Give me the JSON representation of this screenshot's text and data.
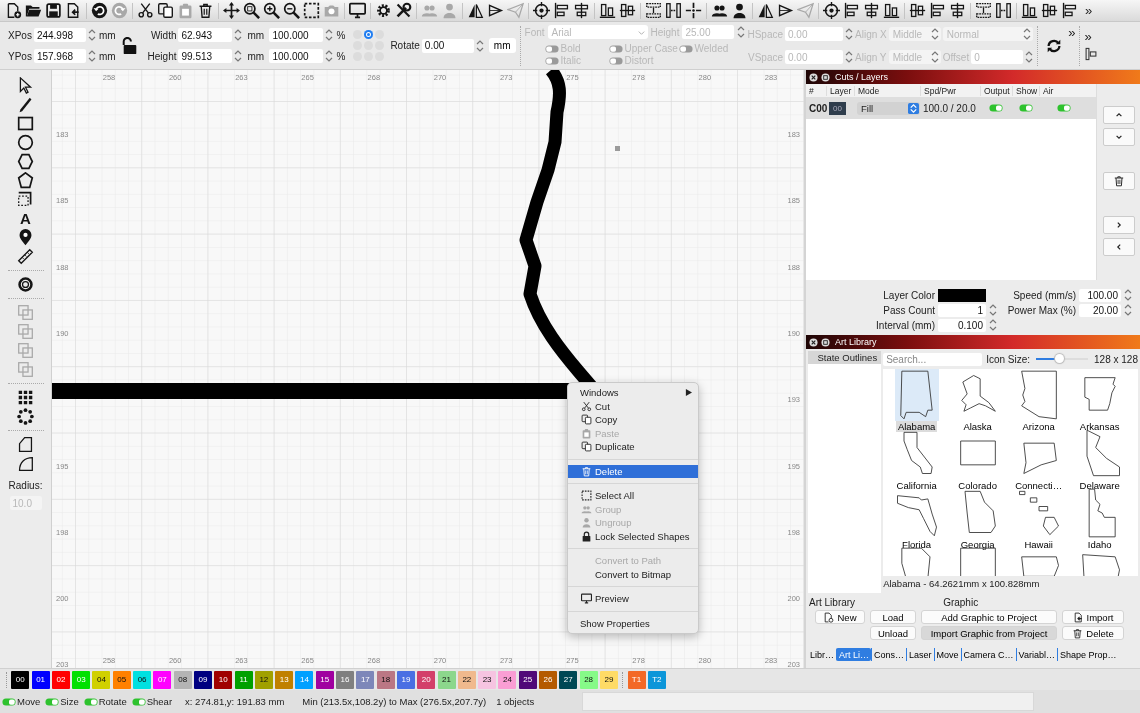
{
  "toolbar": [
    {
      "kind": "file-add",
      "disabled": false
    },
    {
      "kind": "folder",
      "disabled": false
    },
    {
      "kind": "save",
      "disabled": false
    },
    {
      "kind": "import",
      "disabled": false
    },
    {
      "kind": "separator"
    },
    {
      "kind": "undo",
      "disabled": false
    },
    {
      "kind": "redo",
      "disabled": true
    },
    {
      "kind": "separator"
    },
    {
      "kind": "cut",
      "disabled": false
    },
    {
      "kind": "copy",
      "disabled": false
    },
    {
      "kind": "paste",
      "disabled": true
    },
    {
      "kind": "trash",
      "disabled": false
    },
    {
      "kind": "separator"
    },
    {
      "kind": "move",
      "disabled": false
    },
    {
      "kind": "zoom-frame",
      "disabled": false
    },
    {
      "kind": "zoom-in",
      "disabled": false
    },
    {
      "kind": "zoom-out",
      "disabled": false
    },
    {
      "kind": "select",
      "disabled": false
    },
    {
      "kind": "camera",
      "disabled": true
    },
    {
      "kind": "separator"
    },
    {
      "kind": "monitor",
      "disabled": false
    },
    {
      "kind": "separator"
    },
    {
      "kind": "gear",
      "disabled": false
    },
    {
      "kind": "wrench",
      "disabled": false
    },
    {
      "kind": "separator"
    },
    {
      "kind": "users",
      "disabled": true
    },
    {
      "kind": "user",
      "disabled": true
    },
    {
      "kind": "separator"
    },
    {
      "kind": "flip",
      "disabled": false
    },
    {
      "kind": "mirror",
      "disabled": false
    },
    {
      "kind": "plane",
      "disabled": true
    },
    {
      "kind": "separator"
    },
    {
      "kind": "target",
      "disabled": false
    },
    {
      "kind": "align-a",
      "disabled": false
    },
    {
      "kind": "align-b",
      "disabled": false
    },
    {
      "kind": "separator"
    },
    {
      "kind": "align-c",
      "disabled": false
    },
    {
      "kind": "align-d",
      "disabled": false
    },
    {
      "kind": "separator"
    },
    {
      "kind": "dist-a",
      "disabled": false
    },
    {
      "kind": "dist-b",
      "disabled": false
    },
    {
      "kind": "cross",
      "disabled": false
    },
    {
      "kind": "separator"
    },
    {
      "kind": "users",
      "disabled": false
    },
    {
      "kind": "user",
      "disabled": false
    },
    {
      "kind": "separator"
    },
    {
      "kind": "flip",
      "disabled": false
    },
    {
      "kind": "mirror",
      "disabled": false
    },
    {
      "kind": "plane",
      "disabled": true
    },
    {
      "kind": "separator"
    },
    {
      "kind": "target",
      "disabled": false
    },
    {
      "kind": "align-a",
      "disabled": false
    },
    {
      "kind": "align-b",
      "disabled": false
    },
    {
      "kind": "align-c",
      "disabled": false
    },
    {
      "kind": "separator"
    },
    {
      "kind": "align-d",
      "disabled": false
    },
    {
      "kind": "align-a",
      "disabled": false
    },
    {
      "kind": "align-b",
      "disabled": false
    },
    {
      "kind": "separator"
    },
    {
      "kind": "dist-a",
      "disabled": false
    },
    {
      "kind": "dist-b",
      "disabled": false
    },
    {
      "kind": "separator"
    },
    {
      "kind": "align-c",
      "disabled": false
    },
    {
      "kind": "align-d",
      "disabled": false
    },
    {
      "kind": "align-a",
      "disabled": false
    }
  ],
  "toolbar_overflow": "»",
  "position": {
    "fields": [
      {
        "label": "XPos",
        "value": "244.998",
        "unit": "mm"
      },
      {
        "label": "YPos",
        "value": "157.968",
        "unit": "mm"
      }
    ],
    "locked": false
  },
  "size": {
    "fields": [
      {
        "label": "Width",
        "value": "62.943",
        "unit": "mm",
        "scale": "100.000",
        "scale_unit": "%"
      },
      {
        "label": "Height",
        "value": "99.513",
        "unit": "mm",
        "scale": "100.000",
        "scale_unit": "%"
      }
    ]
  },
  "origin_points": [
    {
      "selected": false
    },
    {
      "selected": true
    },
    {
      "selected": false
    },
    {
      "selected": false
    },
    {
      "selected": false
    },
    {
      "selected": false
    },
    {
      "selected": false
    },
    {
      "selected": false
    },
    {
      "selected": false
    }
  ],
  "rotate": {
    "label": "Rotate",
    "value": "0.00"
  },
  "unit_button": "mm",
  "text_options": {
    "disabled": true,
    "font": {
      "label": "Font",
      "value": "Arial"
    },
    "height": {
      "label": "Height",
      "value": "25.00"
    },
    "toggles": [
      {
        "label": "Bold",
        "on": false
      },
      {
        "label": "Upper Case",
        "on": false
      },
      {
        "label": "Welded",
        "on": false
      },
      {
        "label": "Italic",
        "on": false
      },
      {
        "label": "Distort",
        "on": false
      }
    ],
    "hspace": {
      "label": "HSpace",
      "value": "0.00"
    },
    "vspace": {
      "label": "VSpace",
      "value": "0.00"
    },
    "align_x": {
      "label": "Align X",
      "value": "Middle"
    },
    "align_y": {
      "label": "Align Y",
      "value": "Middle"
    },
    "mode": "Normal",
    "offset": {
      "label": "Offset",
      "value": "0"
    }
  },
  "panel_overflow": [
    "»",
    "»"
  ],
  "tools": [
    {
      "kind": "pointer",
      "disabled": false
    },
    {
      "kind": "pen",
      "disabled": false
    },
    {
      "kind": "rect",
      "disabled": false
    },
    {
      "kind": "ellipse",
      "disabled": false
    },
    {
      "kind": "hexagon",
      "disabled": false
    },
    {
      "kind": "polygon",
      "disabled": false
    },
    {
      "kind": "dash-square",
      "disabled": false
    },
    {
      "kind": "text",
      "label": "A",
      "disabled": false
    },
    {
      "kind": "pin",
      "disabled": false
    },
    {
      "kind": "ruler",
      "disabled": false
    },
    {
      "kind": "ring",
      "disabled": false
    },
    {
      "kind": "boolean",
      "disabled": true
    },
    {
      "kind": "boolean",
      "disabled": true
    },
    {
      "kind": "boolean",
      "disabled": true
    },
    {
      "kind": "boolean",
      "disabled": true
    },
    {
      "kind": "grid",
      "disabled": false
    },
    {
      "kind": "circle-array",
      "disabled": false
    },
    {
      "kind": "node",
      "disabled": false
    },
    {
      "kind": "node2",
      "disabled": false
    }
  ],
  "radius": {
    "label": "Radius:",
    "value": "10.0",
    "disabled": true
  },
  "canvas": {
    "top_ruler": [
      "258",
      "260",
      "263",
      "265",
      "268",
      "270",
      "273",
      "275",
      "278",
      "280",
      "283"
    ],
    "bottom_ruler": [
      "258",
      "260",
      "263",
      "265",
      "268",
      "270",
      "273",
      "275",
      "278",
      "280",
      "283"
    ],
    "left_ruler": [
      "183",
      "185",
      "188",
      "190",
      "195",
      "198",
      "200",
      "203"
    ],
    "right_ruler": [
      "183",
      "185",
      "188",
      "190",
      "193",
      "195",
      "198",
      "200",
      "203"
    ]
  },
  "context_menu": {
    "items": [
      {
        "kind": "plain",
        "label": "Windows",
        "submenu": true,
        "disabled": false,
        "selected": false
      },
      {
        "kind": "cut",
        "label": "Cut",
        "disabled": false,
        "selected": false
      },
      {
        "kind": "copy",
        "label": "Copy",
        "disabled": false,
        "selected": false
      },
      {
        "kind": "paste",
        "label": "Paste",
        "disabled": true,
        "selected": false
      },
      {
        "kind": "duplicate",
        "label": "Duplicate",
        "disabled": false,
        "selected": false
      },
      {
        "kind": "separator"
      },
      {
        "kind": "delete",
        "label": "Delete",
        "disabled": false,
        "selected": true
      },
      {
        "kind": "separator"
      },
      {
        "kind": "select-all",
        "label": "Select All",
        "disabled": false,
        "selected": false
      },
      {
        "kind": "group",
        "label": "Group",
        "disabled": true,
        "selected": false
      },
      {
        "kind": "ungroup",
        "label": "Ungroup",
        "disabled": true,
        "selected": false
      },
      {
        "kind": "lock",
        "label": "Lock Selected Shapes",
        "disabled": false,
        "selected": false
      },
      {
        "kind": "separator"
      },
      {
        "kind": "blank",
        "label": "Convert to Path",
        "disabled": true,
        "selected": false
      },
      {
        "kind": "blank",
        "label": "Convert to Bitmap",
        "disabled": false,
        "selected": false
      },
      {
        "kind": "separator"
      },
      {
        "kind": "preview",
        "label": "Preview",
        "disabled": false,
        "selected": false
      },
      {
        "kind": "separator"
      },
      {
        "kind": "plain",
        "label": "Show Properties",
        "disabled": false,
        "selected": false
      }
    ]
  },
  "cuts_layers": {
    "title": "Cuts / Layers",
    "columns": [
      "#",
      "Layer",
      "Mode",
      "Spd/Pwr",
      "Output",
      "Show",
      "Air"
    ],
    "rows": [
      {
        "number": "C00",
        "layer": "00",
        "mode": "Fill",
        "speed_power": "100.0 / 20.0",
        "output": true,
        "show": true,
        "air": true,
        "selected": true
      }
    ],
    "side_buttons": [
      {
        "kind": "up"
      },
      {
        "kind": "down"
      },
      {
        "kind": "trash"
      },
      {
        "kind": "right"
      },
      {
        "kind": "left"
      }
    ],
    "layer_color": {
      "label": "Layer Color",
      "color": "#000000"
    },
    "speed": {
      "label": "Speed (mm/s)",
      "value": "100.00"
    },
    "pass_count": {
      "label": "Pass Count",
      "value": "1"
    },
    "power_max": {
      "label": "Power Max (%)",
      "value": "20.00"
    },
    "interval": {
      "label": "Interval (mm)",
      "value": "0.100"
    }
  },
  "art_library": {
    "title": "Art Library",
    "libraries": [
      {
        "label": "State Outlines",
        "selected": true
      }
    ],
    "search": {
      "placeholder": "Search..."
    },
    "icon_size": {
      "label": "Icon Size:",
      "level": 0.45,
      "reading": "128 x 128"
    },
    "items": [
      {
        "name": "Alabama",
        "selected": true
      },
      {
        "name": "Alaska",
        "selected": false
      },
      {
        "name": "Arizona",
        "selected": false
      },
      {
        "name": "Arkansas",
        "selected": false
      },
      {
        "name": "California",
        "selected": false
      },
      {
        "name": "Colorado",
        "selected": false
      },
      {
        "name": "Connecti…",
        "selected": false
      },
      {
        "name": "Delaware",
        "selected": false
      },
      {
        "name": "Florida",
        "selected": false
      },
      {
        "name": "Georgia",
        "selected": false
      },
      {
        "name": "Hawaii",
        "selected": false
      },
      {
        "name": "Idaho",
        "selected": false
      },
      {
        "selected": false
      },
      {
        "selected": false
      },
      {
        "selected": false
      },
      {
        "selected": false
      }
    ],
    "info": "Alabama - 64.2621mm x 100.828mm",
    "library_label": "Art Library",
    "graphic_label": "Graphic",
    "buttons": [
      {
        "kind": "new",
        "label": "New",
        "default": false
      },
      {
        "kind": "load",
        "label": "Load",
        "default": false
      },
      {
        "kind": "add",
        "label": "Add Graphic to Project",
        "default": false
      },
      {
        "kind": "import",
        "label": "Import",
        "default": false
      },
      {
        "kind": "unload",
        "label": "Unload",
        "default": false
      },
      {
        "kind": "import-from",
        "label": "Import Graphic from Project",
        "default": true
      },
      {
        "kind": "delete",
        "label": "Delete",
        "default": false
      }
    ]
  },
  "dock_tabs": [
    {
      "label": "Libr…",
      "selected": false
    },
    {
      "label": "Art Li…",
      "selected": true
    },
    {
      "label": "Cons…",
      "selected": false
    },
    {
      "label": "Laser",
      "selected": false
    },
    {
      "label": "Move",
      "selected": false
    },
    {
      "label": "Camera C…",
      "selected": false
    },
    {
      "label": "Variabl…",
      "selected": false
    },
    {
      "label": "Shape Prop…",
      "selected": false
    }
  ],
  "palette": [
    {
      "label": "00",
      "color": "#000000"
    },
    {
      "label": "01",
      "color": "#0000ff"
    },
    {
      "label": "02",
      "color": "#ff0000"
    },
    {
      "label": "03",
      "color": "#00e000"
    },
    {
      "label": "04",
      "color": "#d0d000"
    },
    {
      "label": "05",
      "color": "#ff8000"
    },
    {
      "label": "06",
      "color": "#00e0e0"
    },
    {
      "label": "07",
      "color": "#ff00ff"
    },
    {
      "label": "08",
      "color": "#b4b4b4"
    },
    {
      "label": "09",
      "color": "#000080"
    },
    {
      "label": "10",
      "color": "#a00000"
    },
    {
      "label": "11",
      "color": "#00a000"
    },
    {
      "label": "12",
      "color": "#a0a000"
    },
    {
      "label": "13",
      "color": "#c08000"
    },
    {
      "label": "14",
      "color": "#00a0ff"
    },
    {
      "label": "15",
      "color": "#a000a0"
    },
    {
      "label": "16",
      "color": "#808080"
    },
    {
      "label": "17",
      "color": "#7d87b9"
    },
    {
      "label": "18",
      "color": "#bb7784"
    },
    {
      "label": "19",
      "color": "#4a6fe3"
    },
    {
      "label": "20",
      "color": "#d33f6a"
    },
    {
      "label": "21",
      "color": "#8cd78c"
    },
    {
      "label": "22",
      "color": "#f0b98d"
    },
    {
      "label": "23",
      "color": "#f6c4e1"
    },
    {
      "label": "24",
      "color": "#fa9ed4"
    },
    {
      "label": "25",
      "color": "#500a78"
    },
    {
      "label": "26",
      "color": "#b45a00"
    },
    {
      "label": "27",
      "color": "#004754"
    },
    {
      "label": "28",
      "color": "#86fa88"
    },
    {
      "label": "29",
      "color": "#ffdb66"
    }
  ],
  "tool_layers": [
    {
      "label": "T1",
      "color": "#f36926"
    },
    {
      "label": "T2",
      "color": "#0c96d9"
    }
  ],
  "status_bar": {
    "toggles": [
      {
        "label": "Move",
        "on": true
      },
      {
        "label": "Size",
        "on": true
      },
      {
        "label": "Rotate",
        "on": true
      },
      {
        "label": "Shear",
        "on": true
      }
    ],
    "coords": "x: 274.81,y: 191.83 mm",
    "bounds": "Min (213.5x,108.2y) to Max (276.5x,207.7y)",
    "count": "1 objects"
  }
}
